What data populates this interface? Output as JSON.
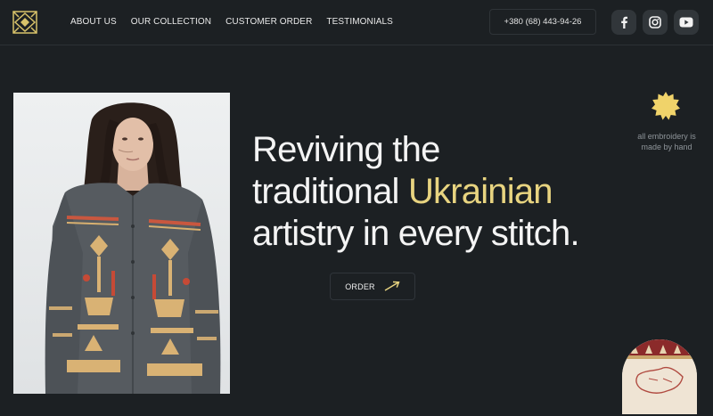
{
  "nav": {
    "items": [
      {
        "label": "ABOUT US"
      },
      {
        "label": "OUR COLLECTION"
      },
      {
        "label": "CUSTOMER ORDER"
      },
      {
        "label": "TESTIMONIALS"
      }
    ]
  },
  "header": {
    "phone": "+380 (68) 443-94-26",
    "social": [
      "facebook-icon",
      "instagram-icon",
      "youtube-icon"
    ]
  },
  "hero": {
    "line1": "Reviving the",
    "line2_prefix": "traditional ",
    "line2_accent": "Ukrainian",
    "line3": "artistry in every stitch.",
    "order_label": "ORDER"
  },
  "side": {
    "note_line1": "all embroidery is",
    "note_line2": "made by hand"
  },
  "colors": {
    "background": "#1c2023",
    "accent": "#e8d480",
    "badge": "#f0d36a",
    "social_bg": "#31363a"
  }
}
